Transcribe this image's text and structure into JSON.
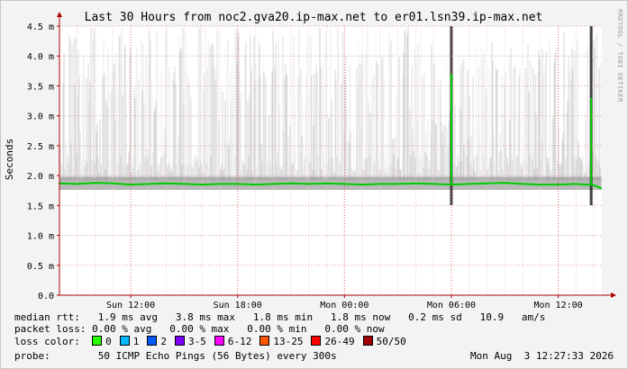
{
  "chart_data": {
    "type": "area",
    "title": "Last 30 Hours from noc2.gva20.ip-max.net to er01.lsn39.ip-max.net",
    "ylabel": "Seconds",
    "xlabel": "",
    "ylim": [
      0,
      4.5
    ],
    "y_unit": "m",
    "y_ticks": [
      "0.0",
      "0.5 m",
      "1.0 m",
      "1.5 m",
      "2.0 m",
      "2.5 m",
      "3.0 m",
      "3.5 m",
      "4.0 m",
      "4.5 m"
    ],
    "x_ticks": [
      {
        "label": "Sun 12:00",
        "t": 4
      },
      {
        "label": "Sun 18:00",
        "t": 10
      },
      {
        "label": "Mon 00:00",
        "t": 16
      },
      {
        "label": "Mon 06:00",
        "t": 22
      },
      {
        "label": "Mon 12:00",
        "t": 28
      }
    ],
    "x_range_hours": [
      0,
      30.45
    ],
    "grid": true,
    "series": [
      {
        "name": "median rtt",
        "color": "#00cc00",
        "x": [
          0,
          1,
          2,
          3,
          4,
          5,
          6,
          7,
          8,
          9,
          10,
          11,
          12,
          13,
          14,
          15,
          16,
          17,
          18,
          19,
          20,
          21,
          22,
          23,
          24,
          25,
          26,
          27,
          28,
          29,
          30,
          30.4
        ],
        "values": [
          1.87,
          1.86,
          1.88,
          1.87,
          1.85,
          1.86,
          1.87,
          1.86,
          1.85,
          1.86,
          1.86,
          1.85,
          1.86,
          1.87,
          1.86,
          1.87,
          1.86,
          1.85,
          1.86,
          1.86,
          1.87,
          1.86,
          1.85,
          1.86,
          1.87,
          1.88,
          1.86,
          1.85,
          1.85,
          1.86,
          1.84,
          1.79
        ]
      }
    ],
    "spikes": [
      {
        "t": 22.0,
        "value": 3.7
      },
      {
        "t": 29.85,
        "value": 3.3
      }
    ]
  },
  "stats": {
    "median_rtt_label": "median rtt:",
    "median_rtt_values": "1.9 ms avg   3.8 ms max   1.8 ms min   1.8 ms now   0.2 ms sd   10.9   am/s",
    "packet_loss_label": "packet loss:",
    "packet_loss_values": "0.00 % avg   0.00 % max   0.00 % min   0.00 % now",
    "loss_color_label": "loss color:",
    "loss_colors": [
      {
        "label": "0",
        "color": "#26ff00"
      },
      {
        "label": "1",
        "color": "#00b8ff"
      },
      {
        "label": "2",
        "color": "#0059ff"
      },
      {
        "label": "3-5",
        "color": "#7e00ff"
      },
      {
        "label": "6-12",
        "color": "#ff00ff"
      },
      {
        "label": "13-25",
        "color": "#ff5500"
      },
      {
        "label": "26-49",
        "color": "#ff0000"
      },
      {
        "label": "50/50",
        "color": "#a10000"
      }
    ],
    "probe_label": "probe:",
    "probe_values": "50 ICMP Echo Pings (56 Bytes) every 300s",
    "timestamp": "Mon Aug  3 12:27:33 2026"
  },
  "side_text": "RRDTOOL / TOBI OETIKER"
}
